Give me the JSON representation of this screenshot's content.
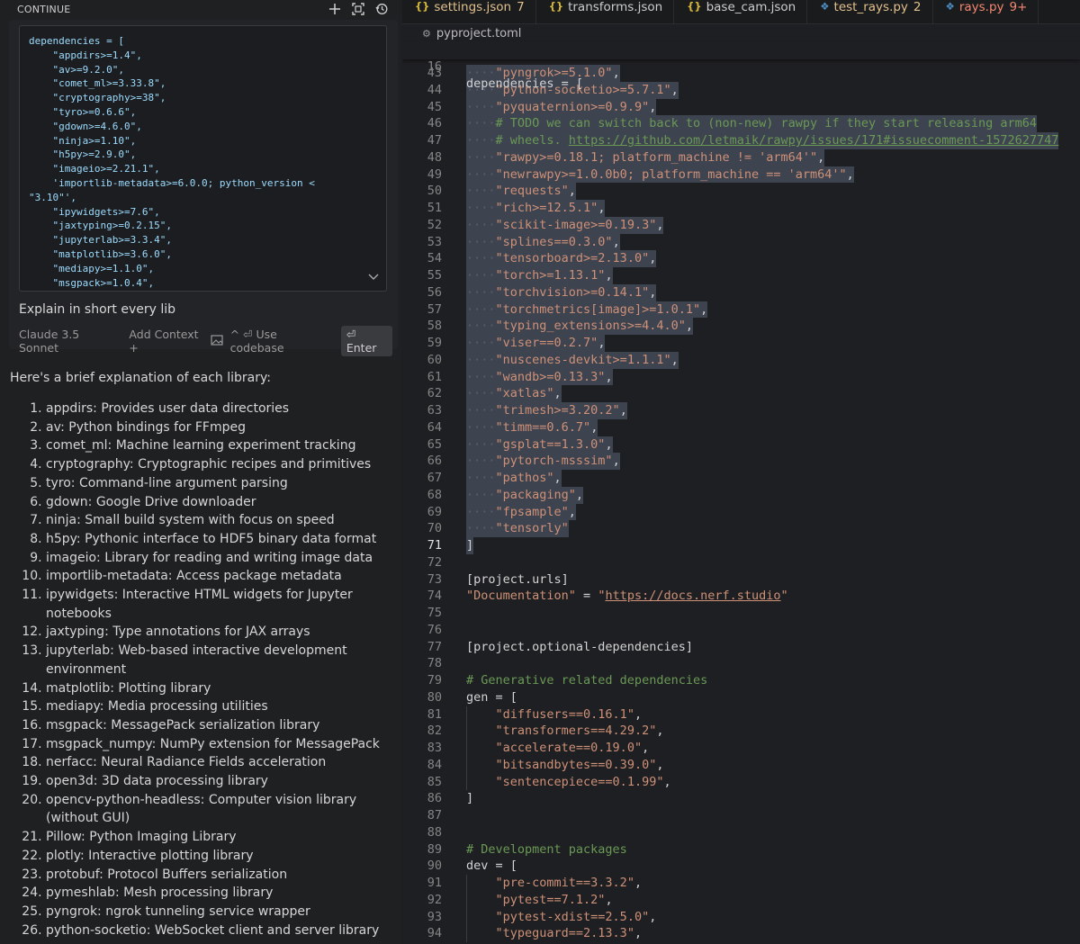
{
  "left": {
    "header": "CONTINUE",
    "code": "dependencies = [\n    \"appdirs>=1.4\",\n    \"av>=9.2.0\",\n    \"comet_ml>=3.33.8\",\n    \"cryptography>=38\",\n    \"tyro>=0.6.6\",\n    \"gdown>=4.6.0\",\n    \"ninja>=1.10\",\n    \"h5py>=2.9.0\",\n    \"imageio>=2.21.1\",\n    'importlib-metadata>=6.0.0; python_version <\n\"3.10\"',\n    \"ipywidgets>=7.6\",\n    \"jaxtyping>=0.2.15\",\n    \"jupyterlab>=3.3.4\",\n    \"matplotlib>=3.6.0\",\n    \"mediapy>=1.1.0\",\n    \"msgpack>=1.0.4\",",
    "prompt": "Explain in short every lib",
    "model": "Claude 3.5 Sonnet",
    "add_context": "Add Context +",
    "use_codebase": "^ ⏎ Use codebase",
    "enter": "⏎ Enter",
    "answer_intro": "Here's a brief explanation of each library:",
    "libs": [
      "appdirs: Provides user data directories",
      "av: Python bindings for FFmpeg",
      "comet_ml: Machine learning experiment tracking",
      "cryptography: Cryptographic recipes and primitives",
      "tyro: Command-line argument parsing",
      "gdown: Google Drive downloader",
      "ninja: Small build system with focus on speed",
      "h5py: Pythonic interface to HDF5 binary data format",
      "imageio: Library for reading and writing image data",
      "importlib-metadata: Access package metadata",
      "ipywidgets: Interactive HTML widgets for Jupyter notebooks",
      "jaxtyping: Type annotations for JAX arrays",
      "jupyterlab: Web-based interactive development environment",
      "matplotlib: Plotting library",
      "mediapy: Media processing utilities",
      "msgpack: MessagePack serialization library",
      "msgpack_numpy: NumPy extension for MessagePack",
      "nerfacc: Neural Radiance Fields acceleration",
      "open3d: 3D data processing library",
      "opencv-python-headless: Computer vision library (without GUI)",
      "Pillow: Python Imaging Library",
      "plotly: Interactive plotting library",
      "protobuf: Protocol Buffers serialization",
      "pymeshlab: Mesh processing library",
      "pyngrok: ngrok tunneling service wrapper",
      "python-socketio: WebSocket client and server library"
    ]
  },
  "tabs": [
    {
      "icon": "{}",
      "kind": "json",
      "label": "settings.json",
      "count": "7",
      "state": "modified"
    },
    {
      "icon": "{}",
      "kind": "json",
      "label": "transforms.json",
      "count": "",
      "state": ""
    },
    {
      "icon": "{}",
      "kind": "json",
      "label": "base_cam.json",
      "count": "",
      "state": ""
    },
    {
      "icon": "py",
      "kind": "py",
      "label": "test_rays.py",
      "count": "2",
      "state": "modified"
    },
    {
      "icon": "py",
      "kind": "py",
      "label": "rays.py",
      "count": "9+",
      "state": "error"
    }
  ],
  "breadcrumb": "pyproject.toml",
  "sticky": {
    "ln": "16",
    "text": "dependencies = ["
  },
  "editor_lines": [
    {
      "ln": "43",
      "text": "    \"pyngrok>=5.1.0\",",
      "sel": true
    },
    {
      "ln": "44",
      "text": "    \"python-socketio>=5.7.1\",",
      "sel": true
    },
    {
      "ln": "45",
      "text": "    \"pyquaternion>=0.9.9\",",
      "sel": true
    },
    {
      "ln": "46",
      "text": "    # TODO we can switch back to (non-new) rawpy if they start releasing arm64",
      "sel": true,
      "comment": true
    },
    {
      "ln": "47",
      "text": "    # wheels. https://github.com/letmaik/rawpy/issues/171#issuecomment-1572627747",
      "sel": true,
      "comment": true
    },
    {
      "ln": "48",
      "text": "    \"rawpy>=0.18.1; platform_machine != 'arm64'\",",
      "sel": true
    },
    {
      "ln": "49",
      "text": "    \"newrawpy>=1.0.0b0; platform_machine == 'arm64'\",",
      "sel": true
    },
    {
      "ln": "50",
      "text": "    \"requests\",",
      "sel": true
    },
    {
      "ln": "51",
      "text": "    \"rich>=12.5.1\",",
      "sel": true
    },
    {
      "ln": "52",
      "text": "    \"scikit-image>=0.19.3\",",
      "sel": true
    },
    {
      "ln": "53",
      "text": "    \"splines==0.3.0\",",
      "sel": true
    },
    {
      "ln": "54",
      "text": "    \"tensorboard>=2.13.0\",",
      "sel": true
    },
    {
      "ln": "55",
      "text": "    \"torch>=1.13.1\",",
      "sel": true
    },
    {
      "ln": "56",
      "text": "    \"torchvision>=0.14.1\",",
      "sel": true
    },
    {
      "ln": "57",
      "text": "    \"torchmetrics[image]>=1.0.1\",",
      "sel": true
    },
    {
      "ln": "58",
      "text": "    \"typing_extensions>=4.4.0\",",
      "sel": true
    },
    {
      "ln": "59",
      "text": "    \"viser==0.2.7\",",
      "sel": true
    },
    {
      "ln": "60",
      "text": "    \"nuscenes-devkit>=1.1.1\",",
      "sel": true
    },
    {
      "ln": "61",
      "text": "    \"wandb>=0.13.3\",",
      "sel": true
    },
    {
      "ln": "62",
      "text": "    \"xatlas\",",
      "sel": true
    },
    {
      "ln": "63",
      "text": "    \"trimesh>=3.20.2\",",
      "sel": true
    },
    {
      "ln": "64",
      "text": "    \"timm==0.6.7\",",
      "sel": true
    },
    {
      "ln": "65",
      "text": "    \"gsplat==1.3.0\",",
      "sel": true
    },
    {
      "ln": "66",
      "text": "    \"pytorch-msssim\",",
      "sel": true
    },
    {
      "ln": "67",
      "text": "    \"pathos\",",
      "sel": true
    },
    {
      "ln": "68",
      "text": "    \"packaging\",",
      "sel": true
    },
    {
      "ln": "69",
      "text": "    \"fpsample\",",
      "sel": true
    },
    {
      "ln": "70",
      "text": "    \"tensorly\"",
      "sel": true
    },
    {
      "ln": "71",
      "text": "]",
      "sel": true,
      "current": true
    },
    {
      "ln": "72",
      "text": ""
    },
    {
      "ln": "73",
      "text": "[project.urls]"
    },
    {
      "ln": "74",
      "text": "\"Documentation\" = \"https://docs.nerf.studio\""
    },
    {
      "ln": "75",
      "text": ""
    },
    {
      "ln": "76",
      "text": ""
    },
    {
      "ln": "77",
      "text": "[project.optional-dependencies]"
    },
    {
      "ln": "78",
      "text": ""
    },
    {
      "ln": "79",
      "text": "# Generative related dependencies",
      "comment": true
    },
    {
      "ln": "80",
      "text": "gen = ["
    },
    {
      "ln": "81",
      "text": "    \"diffusers==0.16.1\","
    },
    {
      "ln": "82",
      "text": "    \"transformers==4.29.2\","
    },
    {
      "ln": "83",
      "text": "    \"accelerate==0.19.0\","
    },
    {
      "ln": "84",
      "text": "    \"bitsandbytes==0.39.0\","
    },
    {
      "ln": "85",
      "text": "    \"sentencepiece==0.1.99\","
    },
    {
      "ln": "86",
      "text": "]"
    },
    {
      "ln": "87",
      "text": ""
    },
    {
      "ln": "88",
      "text": ""
    },
    {
      "ln": "89",
      "text": "# Development packages",
      "comment": true
    },
    {
      "ln": "90",
      "text": "dev = ["
    },
    {
      "ln": "91",
      "text": "    \"pre-commit==3.3.2\","
    },
    {
      "ln": "92",
      "text": "    \"pytest==7.1.2\","
    },
    {
      "ln": "93",
      "text": "    \"pytest-xdist==2.5.0\","
    },
    {
      "ln": "94",
      "text": "    \"typeguard==2.13.3\","
    }
  ],
  "colors": {
    "selection": "#3e4350",
    "accent_modified": "#e2c08d",
    "accent_error": "#f48771"
  }
}
